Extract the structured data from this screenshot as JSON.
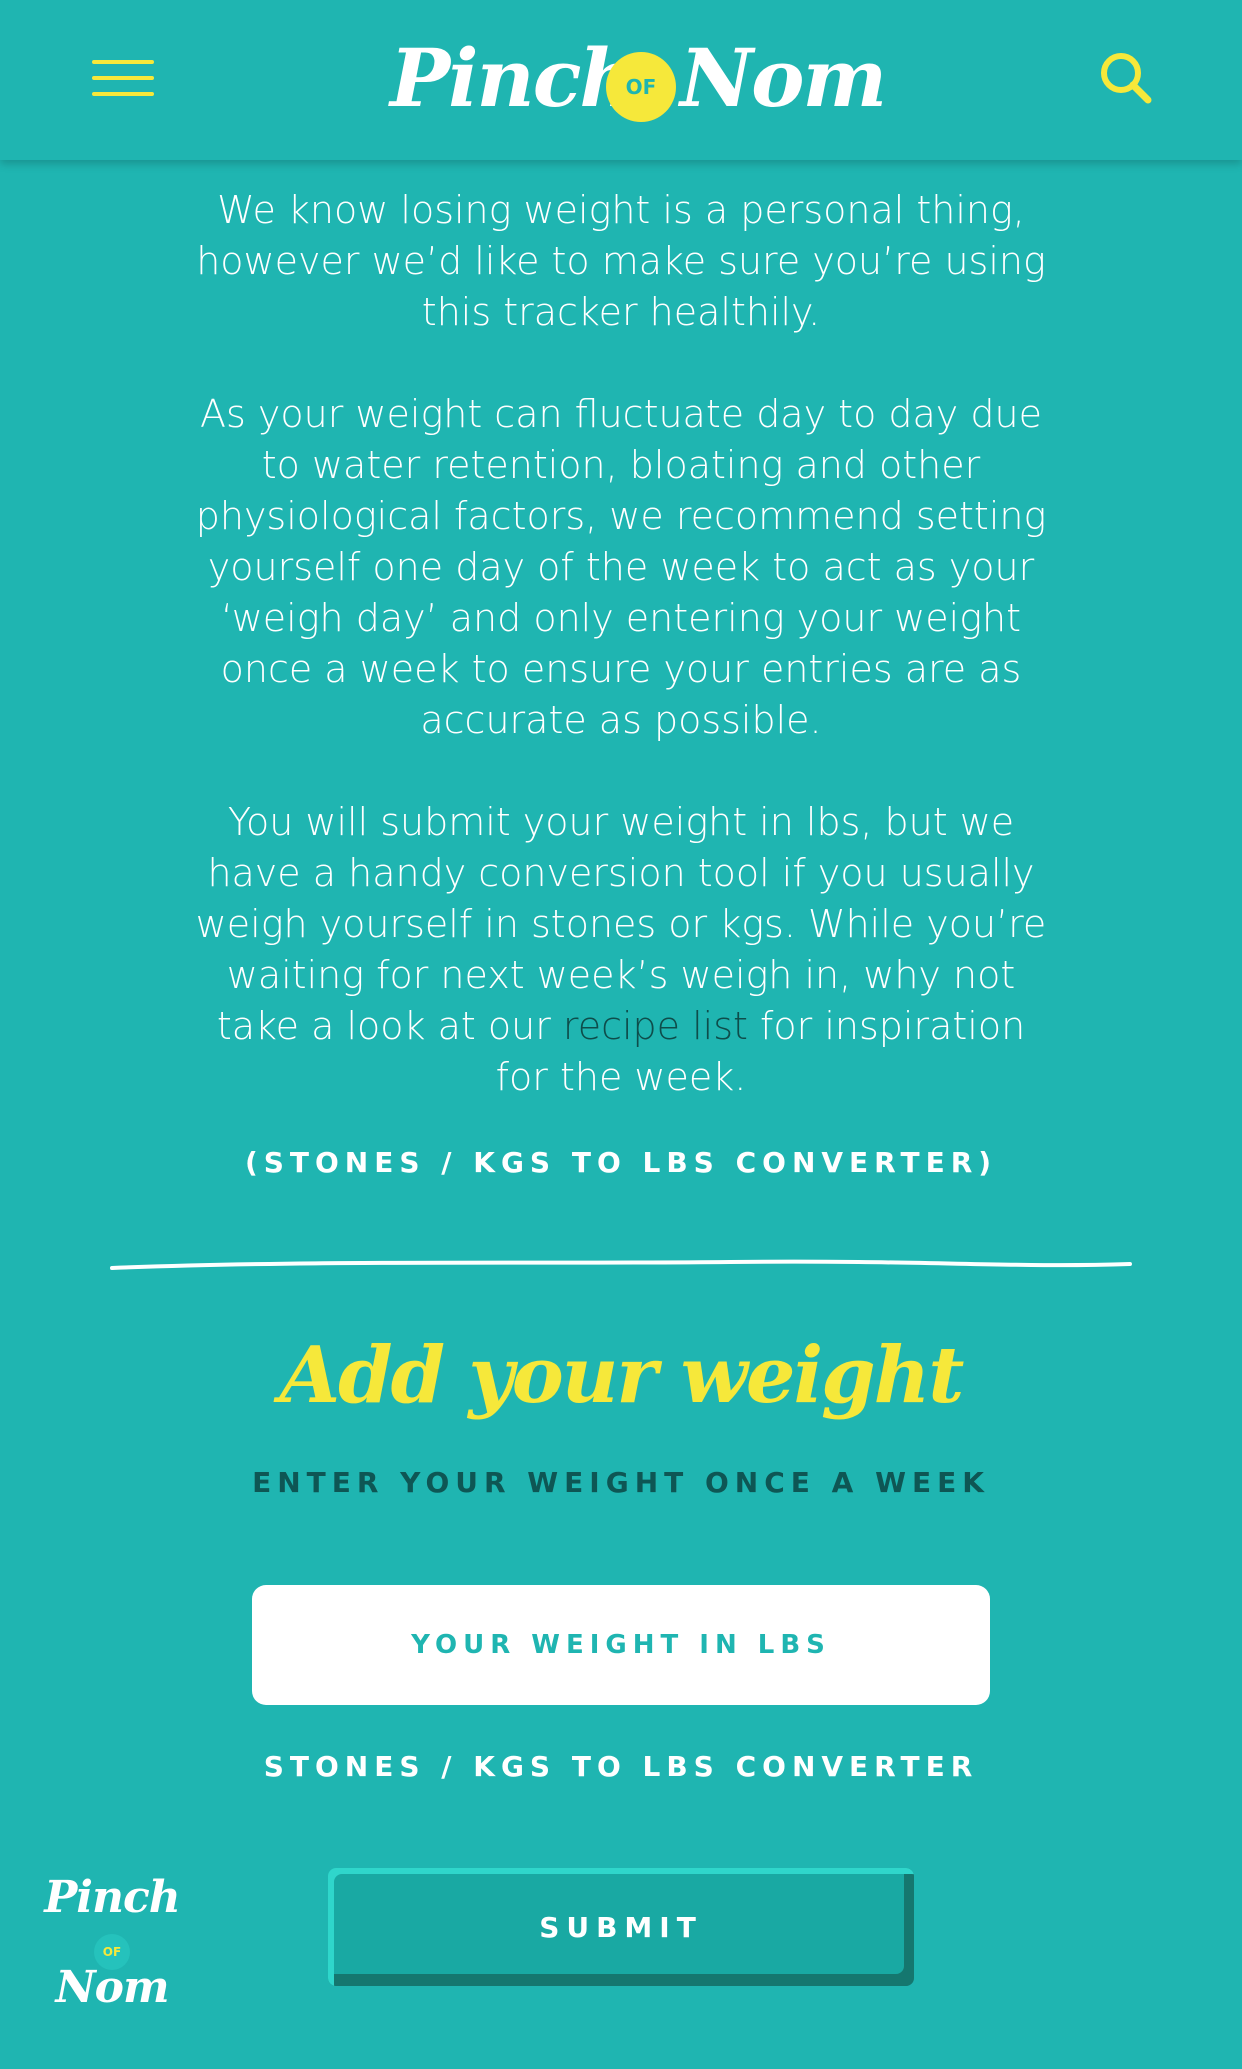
{
  "header": {
    "menu_icon": "hamburger-menu-icon",
    "logo": {
      "word1": "Pinch",
      "of": "OF",
      "word2": "Nom"
    },
    "search_icon": "search-icon"
  },
  "intro": {
    "p1": "We know losing weight is a personal thing, however we’d like to make sure you’re using this tracker healthily.",
    "p2": "As your weight can fluctuate day to day due to water retention, bloating and other physiological factors, we recommend setting yourself one day of the week to act as your ‘weigh day’ and only entering your weight once a week to ensure your entries are as accurate as possible.",
    "p3_before": "You will submit your weight in lbs, but we have a handy conversion tool if you usually weigh yourself in stones or kgs. While you’re waiting for next week’s weigh in, why not take a look at our ",
    "p3_link": "recipe list",
    "p3_after": " for inspiration for the week."
  },
  "converter_link_top": "(STONES / KGS TO LBS CONVERTER)",
  "form": {
    "title": "Add your weight",
    "subtitle": "ENTER YOUR WEIGHT ONCE A WEEK",
    "weight_placeholder": "YOUR WEIGHT IN LBS",
    "converter_link": "STONES / KGS TO LBS CONVERTER",
    "submit_label": "SUBMIT"
  },
  "badge": {
    "word1": "Pinch",
    "of": "OF",
    "word2": "Nom"
  },
  "colors": {
    "background": "#1fb5b1",
    "accent": "#f6e83a",
    "dark_text": "#0e5654",
    "link": "#0e4d4b"
  }
}
